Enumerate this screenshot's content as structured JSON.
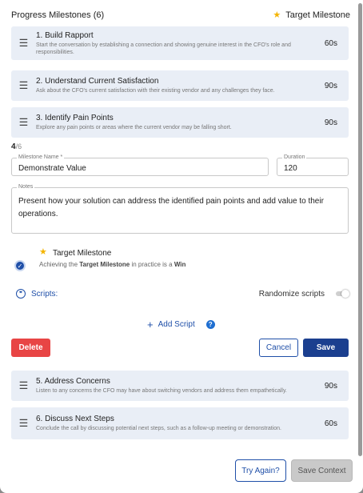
{
  "header": {
    "title": "Progress Milestones (6)",
    "target_label": "Target Milestone"
  },
  "milestones_top": [
    {
      "title": "1. Build Rapport",
      "desc": "Start the conversation by establishing a connection and showing genuine interest in the CFO's role and responsibilities.",
      "duration": "60s"
    },
    {
      "title": "2. Understand Current Satisfaction",
      "desc": "Ask about the CFO's current satisfaction with their existing vendor and any challenges they face.",
      "duration": "90s"
    },
    {
      "title": "3. Identify Pain Points",
      "desc": "Explore any pain points or areas where the current vendor may be falling short.",
      "duration": "90s"
    }
  ],
  "editor": {
    "index": "4",
    "total": "/6",
    "name_label": "Milestone Name *",
    "name_value": "Demonstrate Value",
    "duration_label": "Duration",
    "duration_value": "120",
    "notes_label": "Notes",
    "notes_value": "Present how your solution can address the identified pain points and add value to their operations.",
    "target_title": "Target Milestone",
    "target_desc_prefix": "Achieving the ",
    "target_desc_bold": "Target Milestone",
    "target_desc_mid": " in practice is a ",
    "target_desc_win": "Win",
    "scripts_label": "Scripts:",
    "randomize_label": "Randomize scripts",
    "randomize_on": false,
    "add_script_label": "Add Script",
    "delete_label": "Delete",
    "cancel_label": "Cancel",
    "save_label": "Save"
  },
  "milestones_bottom": [
    {
      "title": "5. Address Concerns",
      "desc": "Listen to any concerns the CFO may have about switching vendors and address them empathetically.",
      "duration": "90s"
    },
    {
      "title": "6. Discuss Next Steps",
      "desc": "Conclude the call by discussing potential next steps, such as a follow-up meeting or demonstration.",
      "duration": "60s"
    }
  ],
  "footer": {
    "try_again_label": "Try Again?",
    "save_context_label": "Save Context"
  },
  "icons": {
    "drag": "drag-handle-icon",
    "star": "star-icon",
    "check": "check-circle-icon",
    "quote": "quote-icon",
    "plus": "plus-icon",
    "help": "help-icon"
  },
  "colors": {
    "accent": "#1f4fa8",
    "save_bg": "#1b3f8f",
    "delete_bg": "#e84545",
    "star": "#f4b400",
    "card_bg": "#e9eef6"
  }
}
